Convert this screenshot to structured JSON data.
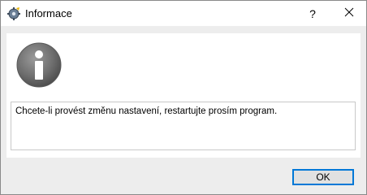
{
  "window": {
    "title": "Informace",
    "help_label": "?",
    "app_icon": "app-gear-icon",
    "close_icon": "close-icon"
  },
  "dialog": {
    "icon": "information-icon",
    "message": "Chcete-li provést změnu nastavení, restartujte prosím program."
  },
  "buttons": {
    "ok_label": "OK"
  },
  "colors": {
    "focus_border": "#0078d7",
    "dialog_background": "#ededed",
    "panel_background": "#ffffff"
  }
}
